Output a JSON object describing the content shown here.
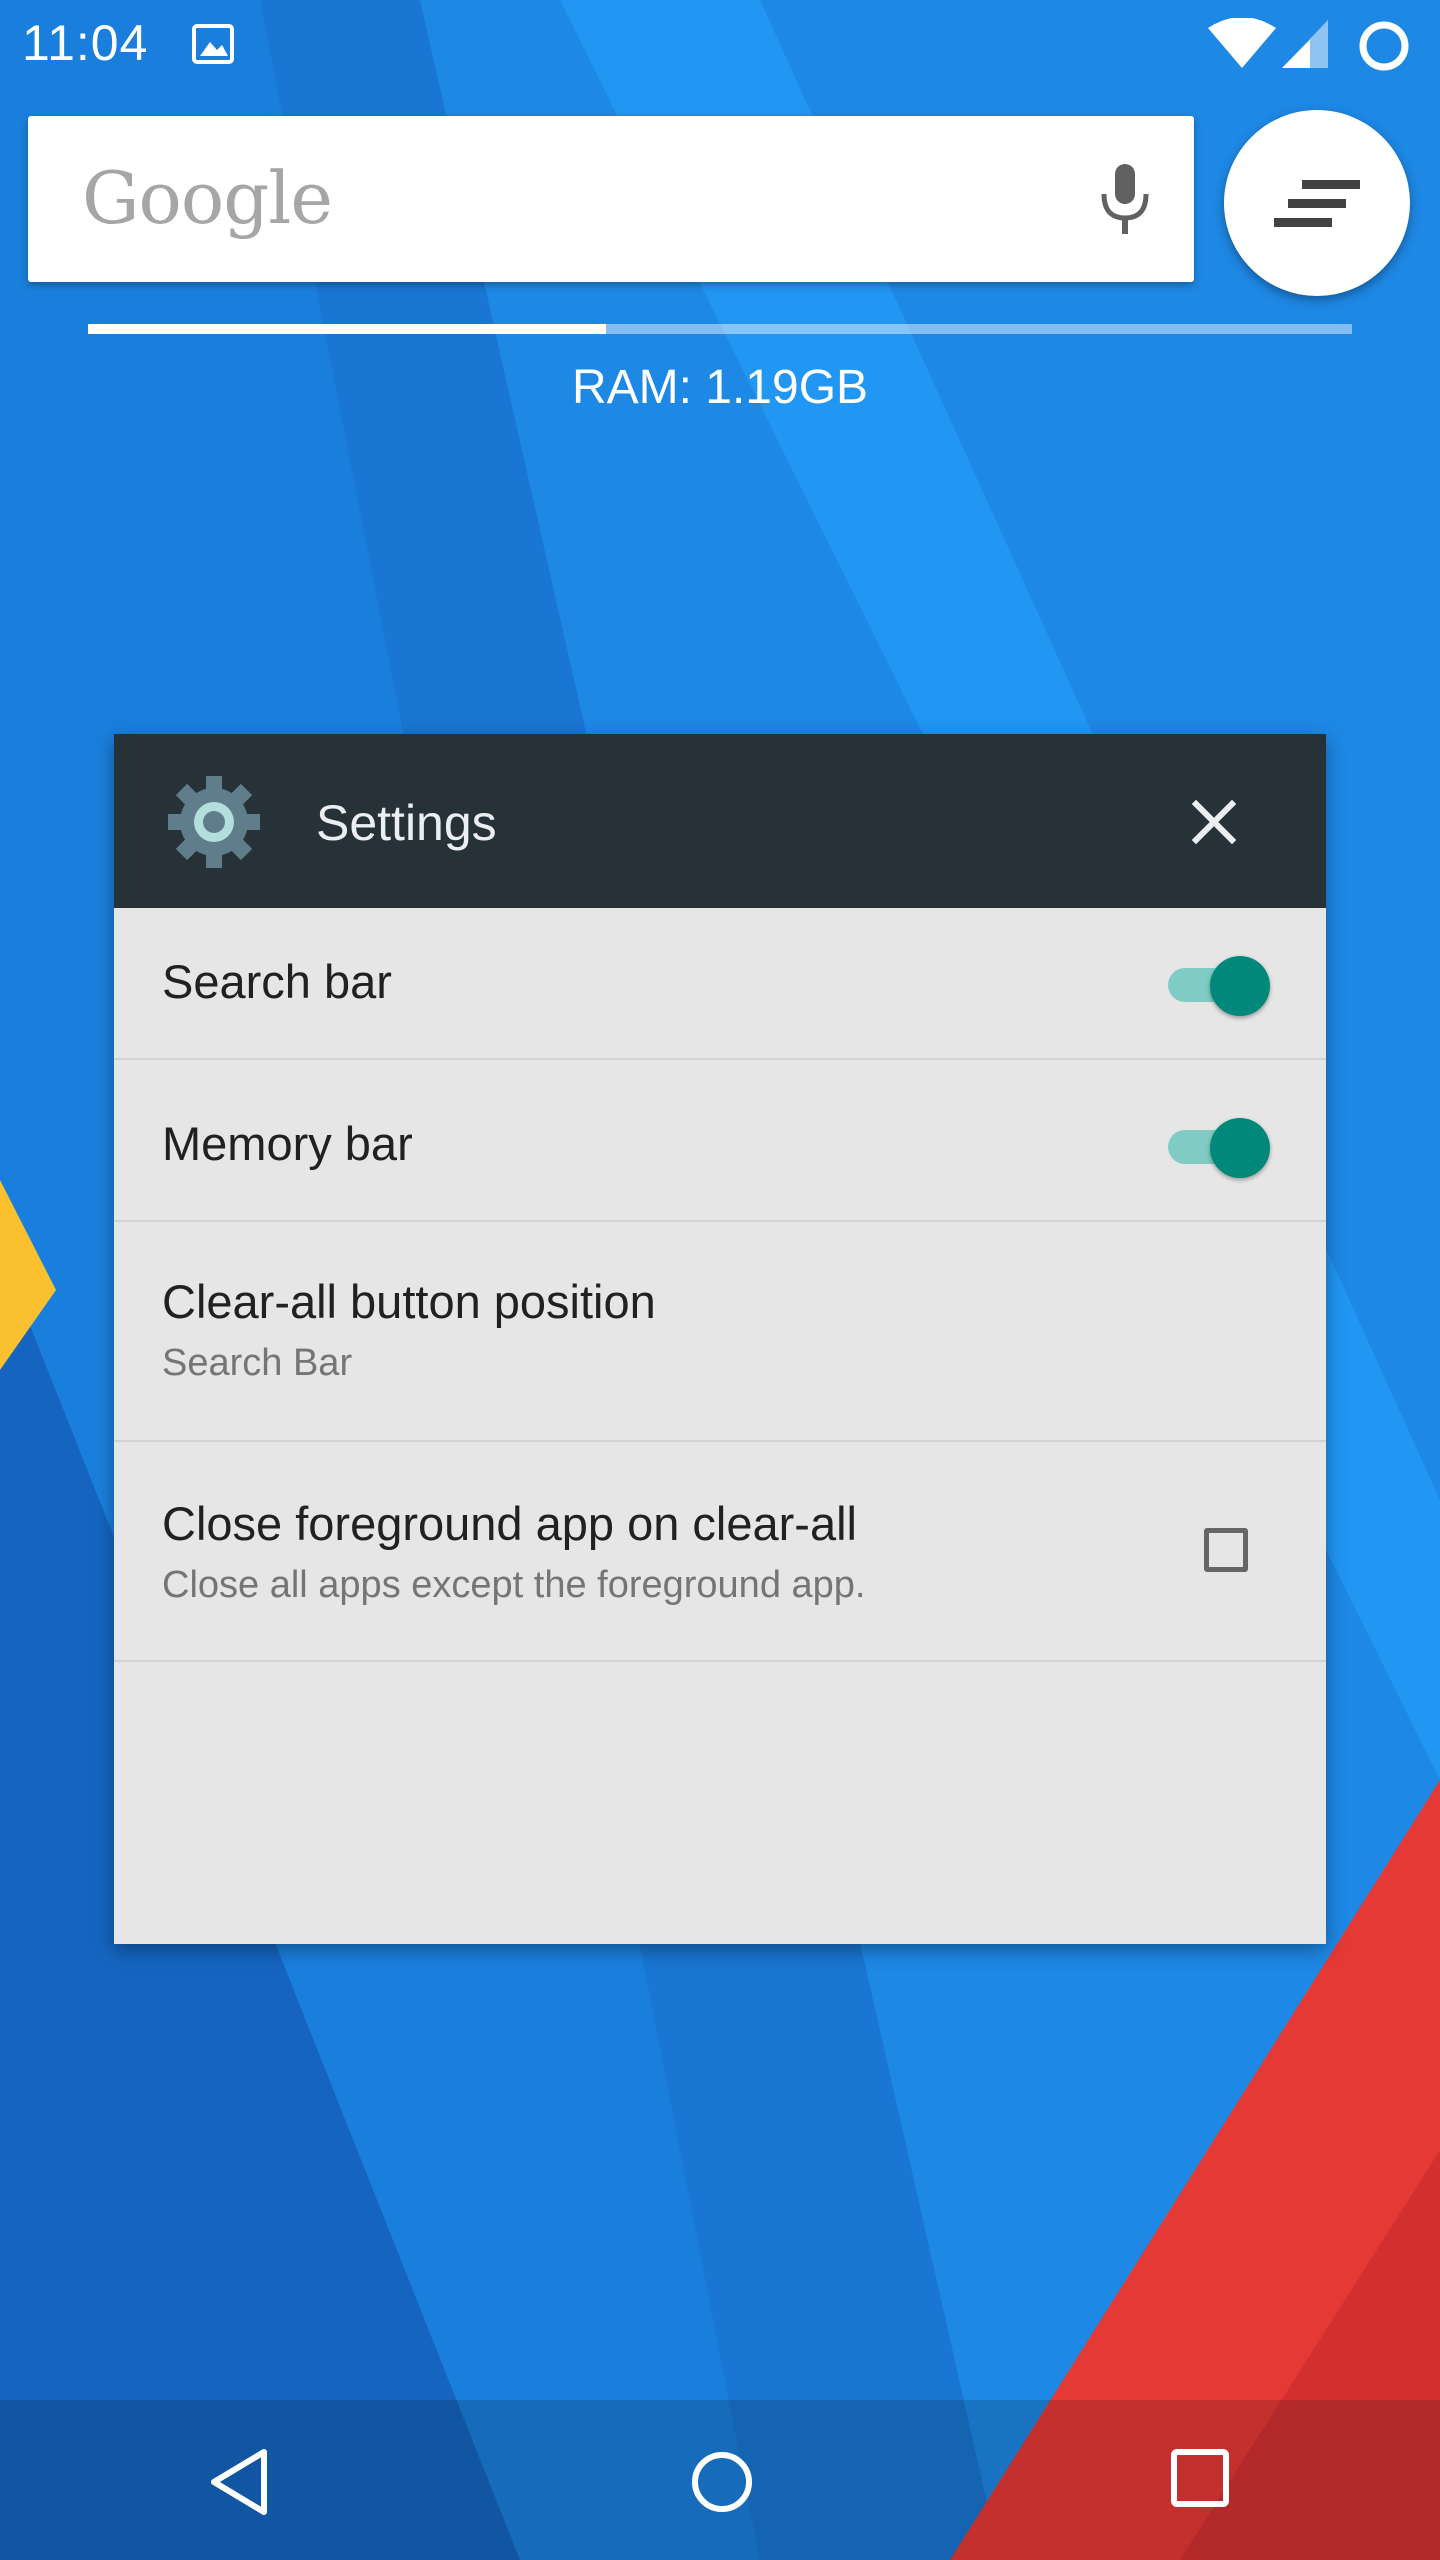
{
  "status_bar": {
    "time": "11:04",
    "icons": [
      "image-notification-icon",
      "wifi-icon",
      "cellular-signal-icon",
      "sync-icon"
    ]
  },
  "search_bar": {
    "logo_text": "Google",
    "mic_icon": "mic-icon"
  },
  "clear_all_button": {
    "icon": "clear-all-icon"
  },
  "memory": {
    "label": "RAM: 1.19GB",
    "used_fraction": 0.41
  },
  "settings_card": {
    "title": "Settings",
    "icon": "settings-gear-icon",
    "close_icon": "close-icon",
    "items": [
      {
        "title": "Search bar",
        "control": "switch",
        "checked": true
      },
      {
        "title": "Memory bar",
        "control": "switch",
        "checked": true
      },
      {
        "title": "Clear-all button position",
        "subtitle": "Search Bar"
      },
      {
        "title": "Close foreground app on clear-all",
        "subtitle": "Close all apps except the foreground app.",
        "control": "checkbox",
        "checked": false
      }
    ]
  },
  "nav_bar": {
    "buttons": [
      "back-icon",
      "home-icon",
      "recents-icon"
    ]
  },
  "colors": {
    "header": "#263238",
    "card_background": "#e6e6e6",
    "switch_accent": "#00897b",
    "wallpaper_blue": "#1e88e5",
    "wallpaper_red": "#e53935",
    "wallpaper_yellow": "#fbc02d"
  }
}
